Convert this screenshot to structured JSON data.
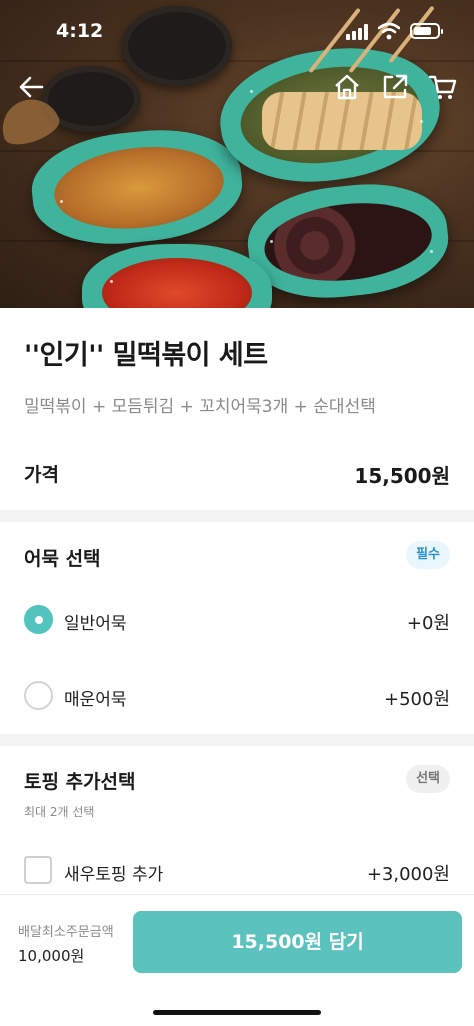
{
  "status_bar": {
    "time": "4:12",
    "battery_level": 0.75
  },
  "nav": {
    "back_icon": "arrow-left-icon",
    "home_icon": "home-icon",
    "share_icon": "share-icon",
    "cart_icon": "cart-icon"
  },
  "product": {
    "title": "''인기'' 밀떡볶이 세트",
    "subtitle": "밀떡볶이 + 모듬튀김 + 꼬치어묵3개 + 순대선택",
    "price_label": "가격",
    "price": "15,500원"
  },
  "sections": [
    {
      "title": "어묵 선택",
      "badge": "필수",
      "options": [
        {
          "name": "일반어묵",
          "price": "+0원",
          "selected": true
        },
        {
          "name": "매운어묵",
          "price": "+500원",
          "selected": false
        }
      ]
    },
    {
      "title": "토핑 추가선택",
      "badge": "선택",
      "hint": "최대 2개 선택",
      "options": [
        {
          "name": "새우토핑 추가",
          "price": "+3,000원",
          "selected": false
        }
      ]
    }
  ],
  "footer": {
    "min_order_label": "배달최소주문금액",
    "min_order_value": "10,000원",
    "cta_label": "15,500원 담기"
  },
  "colors": {
    "accent": "#5cc2bd",
    "required_badge": "#2e8fd0",
    "plate": "#3fb39c"
  }
}
